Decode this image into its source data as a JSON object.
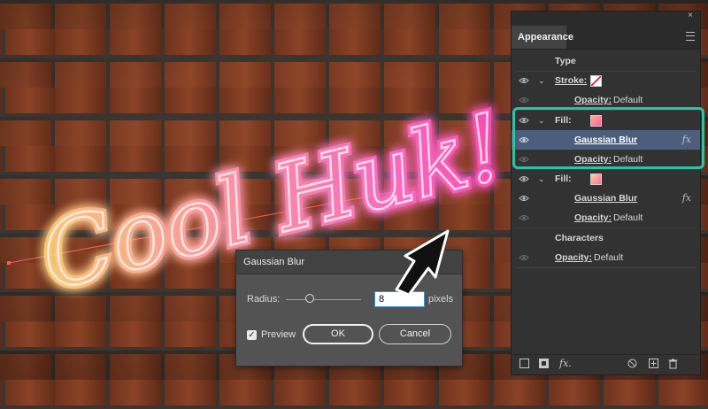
{
  "canvas": {
    "artwork_text": "Cool Huk!",
    "neon_gradient": [
      "#ffd27a",
      "#ff9aa9",
      "#ff6fc8",
      "#ff4fb8"
    ]
  },
  "panel": {
    "title": "Appearance",
    "close_glyph": "×",
    "rows": {
      "type_label": "Type",
      "stroke_label": "Stroke:",
      "stroke_opacity_label": "Opacity:",
      "stroke_opacity_value": "Default",
      "fill1_label": "Fill:",
      "fill1_effect": "Gaussian Blur",
      "fill1_opacity_label": "Opacity:",
      "fill1_opacity_value": "Default",
      "fill2_label": "Fill:",
      "fill2_effect": "Gaussian Blur",
      "fill2_opacity_label": "Opacity:",
      "fill2_opacity_value": "Default",
      "characters_label": "Characters",
      "char_opacity_label": "Opacity:",
      "char_opacity_value": "Default",
      "fx_glyph": "fx"
    },
    "highlight_color": "#27c4a6",
    "selected_row_color": "#4b5f7d",
    "bottom_fx_glyph": "fx."
  },
  "dialog": {
    "title": "Gaussian Blur",
    "radius_label": "Radius:",
    "radius_value": "8",
    "radius_slider_fraction": 0.32,
    "units_label": "pixels",
    "preview_label": "Preview",
    "preview_checked": true,
    "ok_label": "OK",
    "cancel_label": "Cancel"
  }
}
